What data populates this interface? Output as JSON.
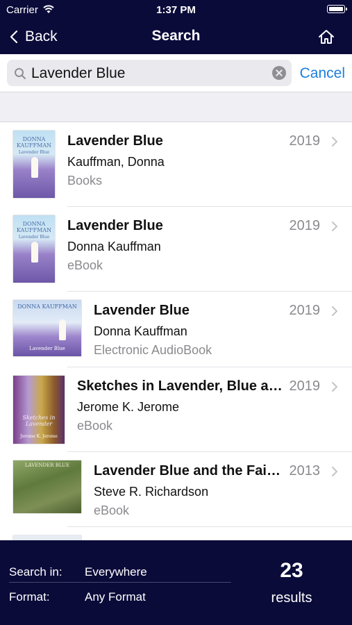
{
  "status": {
    "carrier": "Carrier",
    "time": "1:37 PM"
  },
  "nav": {
    "back": "Back",
    "title": "Search"
  },
  "search": {
    "value": "Lavender Blue",
    "cancel": "Cancel"
  },
  "results": [
    {
      "title": "Lavender Blue",
      "author": "Kauffman, Donna",
      "format": "Books",
      "year": "2019"
    },
    {
      "title": "Lavender Blue",
      "author": "Donna Kauffman",
      "format": "eBook",
      "year": "2019"
    },
    {
      "title": "Lavender Blue",
      "author": "Donna Kauffman",
      "format": "Electronic AudioBook",
      "year": "2019"
    },
    {
      "title": "Sketches in Lavender, Blue and Green",
      "author": "Jerome K. Jerome",
      "format": "eBook",
      "year": "2019"
    },
    {
      "title": "Lavender Blue and the Fairies",
      "author": "Steve R. Richardson",
      "format": "eBook",
      "year": "2013"
    }
  ],
  "covers": [
    {
      "name": "DONNA KAUFFMAN",
      "sub": "Lavender Blue"
    },
    {
      "name": "DONNA KAUFFMAN",
      "sub": "Lavender Blue"
    },
    {
      "name": "DONNA KAUFFMAN",
      "sub": "Lavender Blue"
    },
    {
      "name": "Jerome K. Jerome",
      "sub": "Sketches in Lavender"
    },
    {
      "name": "LAVENDER BLUE",
      "sub": ""
    }
  ],
  "footer": {
    "search_in_label": "Search in:",
    "search_in_value": "Everywhere",
    "format_label": "Format:",
    "format_value": "Any Format",
    "count": "23",
    "count_label": "results"
  }
}
